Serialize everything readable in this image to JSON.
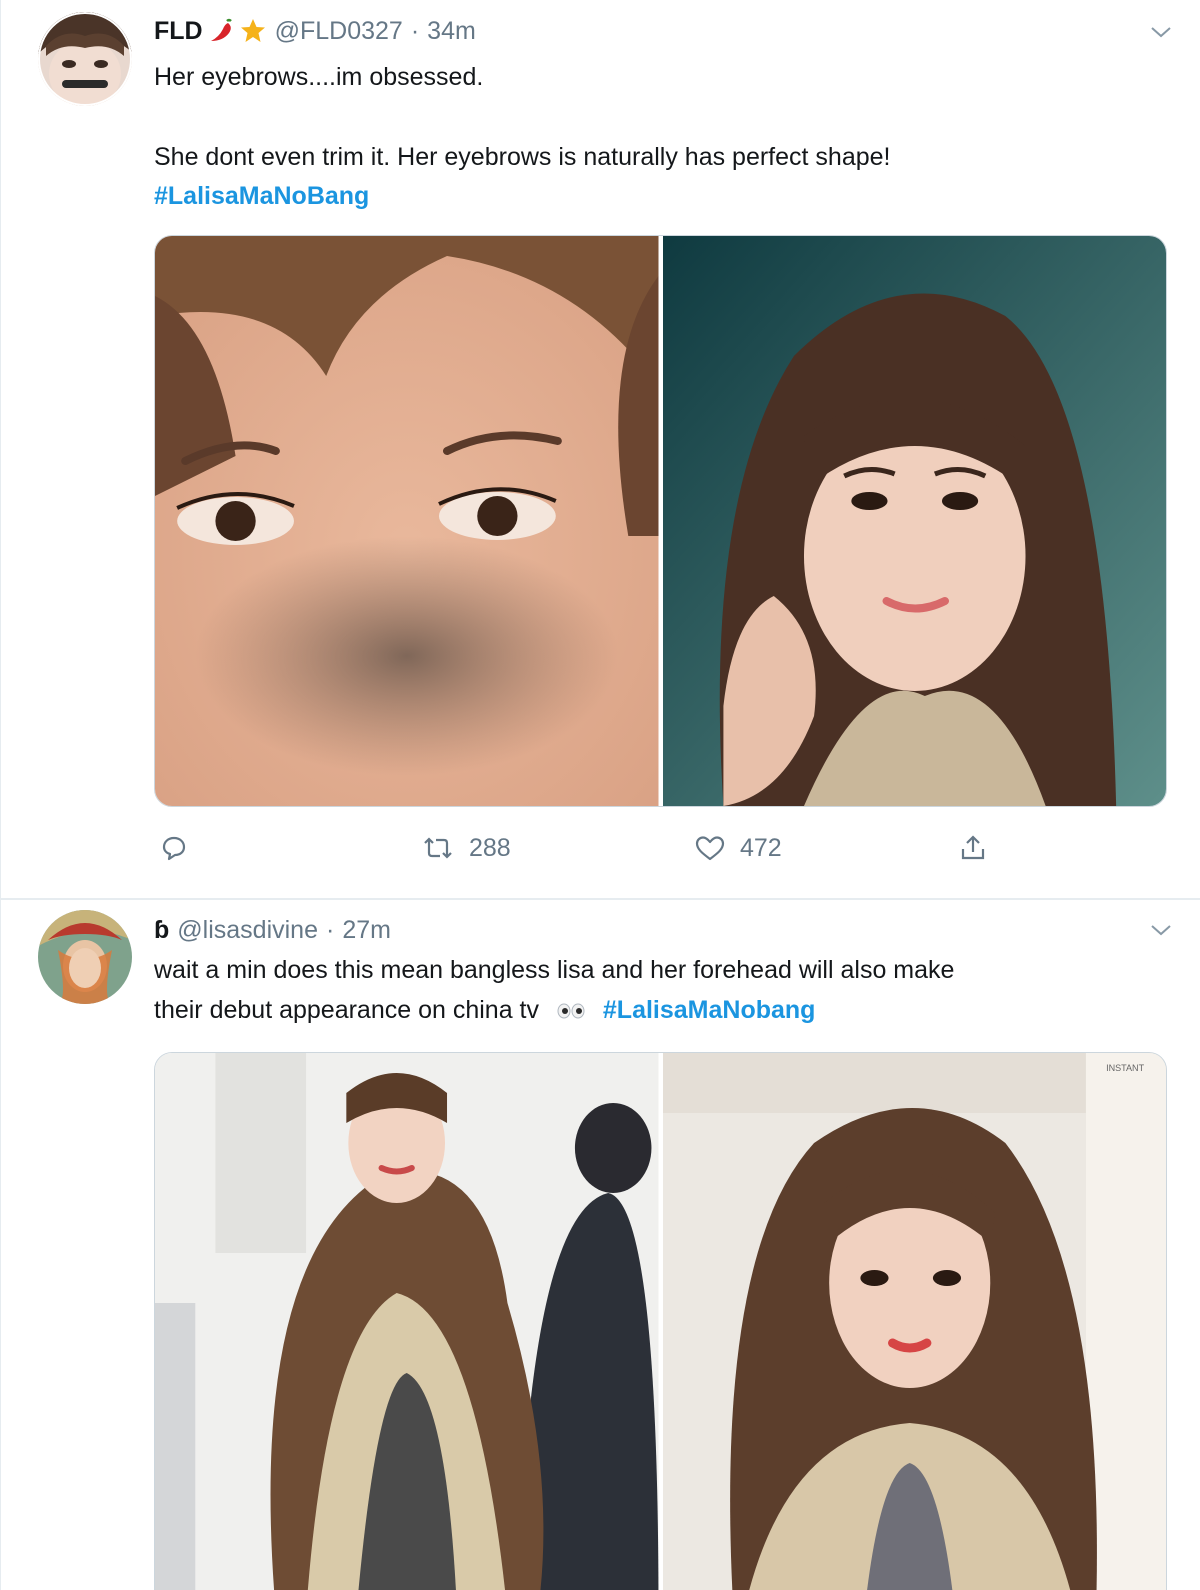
{
  "tweets": [
    {
      "name": "FLD",
      "name_emoji_icons": [
        "chili-pepper-icon",
        "star-icon"
      ],
      "handle": "@FLD0327",
      "separator": "·",
      "time": "34m",
      "text_line_1": "Her eyebrows....im obsessed.",
      "text_line_2": "She dont even trim it. Her eyebrows is naturally has perfect shape!",
      "hashtag": "#LalisaMaNoBang",
      "actions": {
        "reply_count": "",
        "retweet_count": "288",
        "like_count": "472"
      }
    },
    {
      "name": "ɓ",
      "handle": "@lisasdivine",
      "separator": "·",
      "time": "27m",
      "text_line_1": "wait a min does this mean bangless lisa and her forehead will also make",
      "text_line_2": "their debut appearance on china tv",
      "hashtag": "#LalisaMaNobang",
      "inline_icon": "eyes-emoji-icon",
      "photo_watermark": "INSTANT"
    }
  ],
  "colors": {
    "text": "#14171a",
    "secondary": "#657786",
    "hashtag": "#1b95e0",
    "divider": "#e6ecf0",
    "media_border": "#ccd6dd"
  }
}
